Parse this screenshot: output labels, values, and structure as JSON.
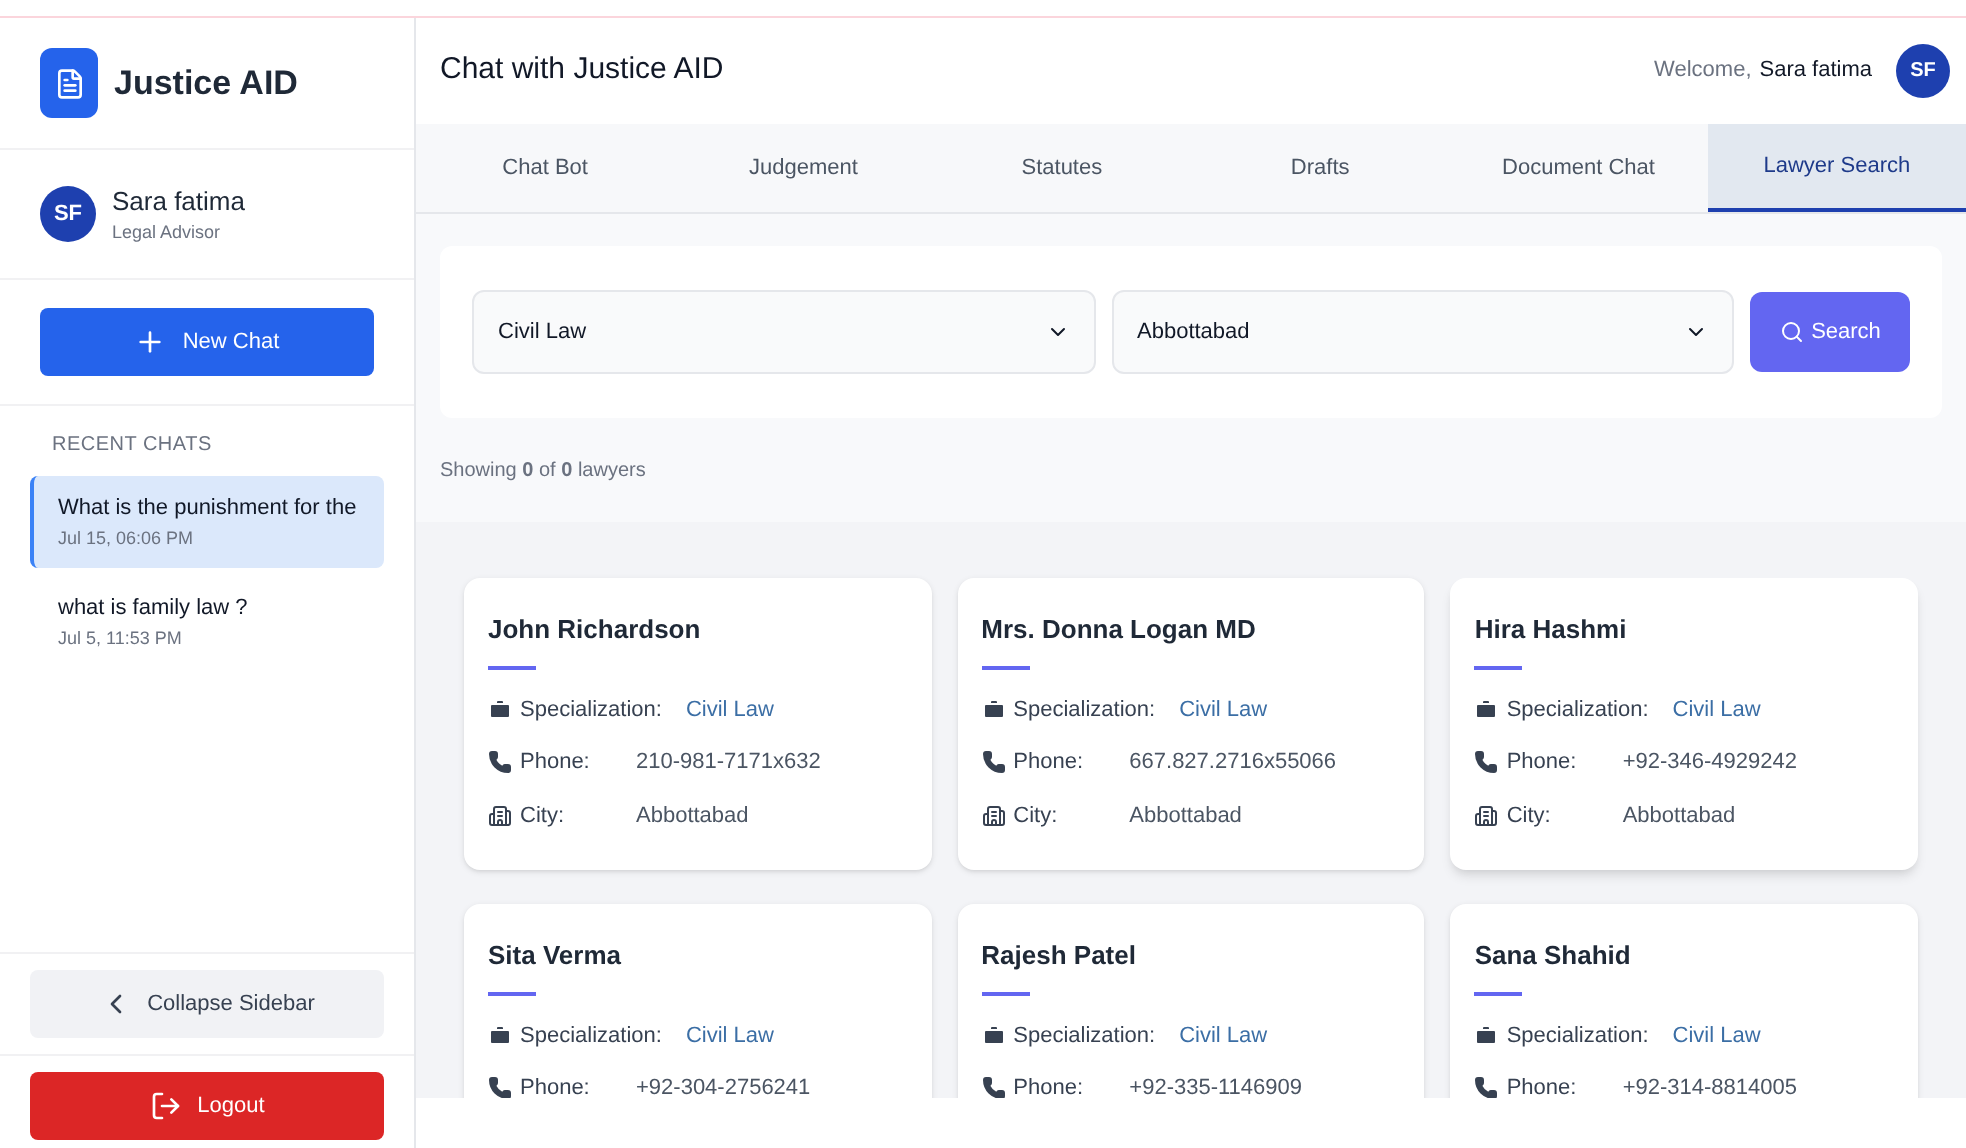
{
  "sidebar": {
    "app_name": "Justice AID",
    "user": {
      "initials": "SF",
      "name": "Sara fatima",
      "role": "Legal Advisor"
    },
    "new_chat": "New Chat",
    "recent_heading": "RECENT CHATS",
    "recent_chats": [
      {
        "title": "What is the punishment for the",
        "time": "Jul 15, 06:06 PM",
        "selected": true
      },
      {
        "title": "what is family law ?",
        "time": "Jul 5, 11:53 PM",
        "selected": false
      }
    ],
    "collapse": "Collapse Sidebar",
    "logout": "Logout"
  },
  "header": {
    "title": "Chat with Justice AID",
    "welcome": "Welcome,",
    "user_name": "Sara fatima",
    "initials": "SF"
  },
  "tabs": [
    {
      "label": "Chat Bot",
      "selected": false
    },
    {
      "label": "Judgement",
      "selected": false
    },
    {
      "label": "Statutes",
      "selected": false
    },
    {
      "label": "Drafts",
      "selected": false
    },
    {
      "label": "Document Chat",
      "selected": false
    },
    {
      "label": "Lawyer Search",
      "selected": true
    }
  ],
  "filters": {
    "specialization": "Civil Law",
    "city": "Abbottabad",
    "search": "Search"
  },
  "result_summary": "Showing **0** of **0** lawyers",
  "lawyers": [
    {
      "name": "John Richardson",
      "fields": [
        {
          "kind": "specialization",
          "label": "Specialization:",
          "value": "Civil Law"
        },
        {
          "kind": "phone",
          "label": "Phone:",
          "value": "210-981-7171x632"
        },
        {
          "kind": "city",
          "label": "City:",
          "value": "Abbottabad"
        }
      ]
    },
    {
      "name": "Mrs. Donna Logan MD",
      "fields": [
        {
          "kind": "specialization",
          "label": "Specialization:",
          "value": "Civil Law"
        },
        {
          "kind": "phone",
          "label": "Phone:",
          "value": "667.827.2716x55066"
        },
        {
          "kind": "city",
          "label": "City:",
          "value": "Abbottabad"
        }
      ]
    },
    {
      "name": "Hira Hashmi",
      "fields": [
        {
          "kind": "specialization",
          "label": "Specialization:",
          "value": "Civil Law"
        },
        {
          "kind": "phone",
          "label": "Phone:",
          "value": "+92-346-4929242"
        },
        {
          "kind": "city",
          "label": "City:",
          "value": "Abbottabad"
        }
      ]
    },
    {
      "name": "Sita Verma",
      "fields": [
        {
          "kind": "specialization",
          "label": "Specialization:",
          "value": "Civil Law"
        },
        {
          "kind": "phone",
          "label": "Phone:",
          "value": "+92-304-2756241"
        }
      ]
    },
    {
      "name": "Rajesh Patel",
      "fields": [
        {
          "kind": "specialization",
          "label": "Specialization:",
          "value": "Civil Law"
        },
        {
          "kind": "phone",
          "label": "Phone:",
          "value": "+92-335-1146909"
        }
      ]
    },
    {
      "name": "Sana Shahid",
      "fields": [
        {
          "kind": "specialization",
          "label": "Specialization:",
          "value": "Civil Law"
        },
        {
          "kind": "phone",
          "label": "Phone:",
          "value": "+92-314-8814005"
        }
      ]
    }
  ]
}
